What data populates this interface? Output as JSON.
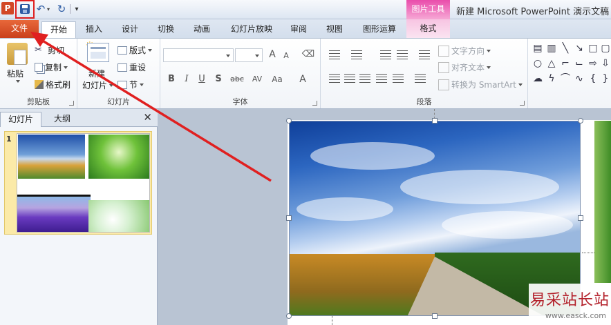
{
  "titlebar": {
    "app_icon_letter": "P",
    "contextual_group": "图片工具",
    "window_title": "新建 Microsoft PowerPoint 演示文稿"
  },
  "tabs": [
    {
      "label": "文件"
    },
    {
      "label": "开始"
    },
    {
      "label": "插入"
    },
    {
      "label": "设计"
    },
    {
      "label": "切换"
    },
    {
      "label": "动画"
    },
    {
      "label": "幻灯片放映"
    },
    {
      "label": "审阅"
    },
    {
      "label": "视图"
    },
    {
      "label": "图形运算"
    },
    {
      "label": "格式"
    }
  ],
  "ribbon": {
    "clipboard": {
      "paste": "粘贴",
      "cut": "剪切",
      "copy": "复制",
      "format_painter": "格式刷",
      "label": "剪贴板"
    },
    "slides": {
      "new_slide_1": "新建",
      "new_slide_2": "幻灯片",
      "layout": "版式",
      "reset": "重设",
      "section": "节",
      "label": "幻灯片"
    },
    "font": {
      "bold": "B",
      "italic": "I",
      "underline": "U",
      "shadow": "S",
      "strike": "abc",
      "spacing": "AV",
      "case": "Aa",
      "color": "A",
      "grow": "A",
      "shrink": "A",
      "label": "字体"
    },
    "paragraph": {
      "text_direction": "文字方向",
      "align_text": "对齐文本",
      "smartart": "转换为 SmartArt",
      "label": "段落"
    }
  },
  "panel": {
    "tab_slides": "幻灯片",
    "tab_outline": "大纲",
    "close": "✕",
    "slide_number": "1"
  },
  "watermark": {
    "main": "易采站长站",
    "url": "www.easck.com"
  },
  "colors": {
    "file_tab": "#d24726",
    "contextual": "#e94dab",
    "annotation": "#e02020"
  }
}
